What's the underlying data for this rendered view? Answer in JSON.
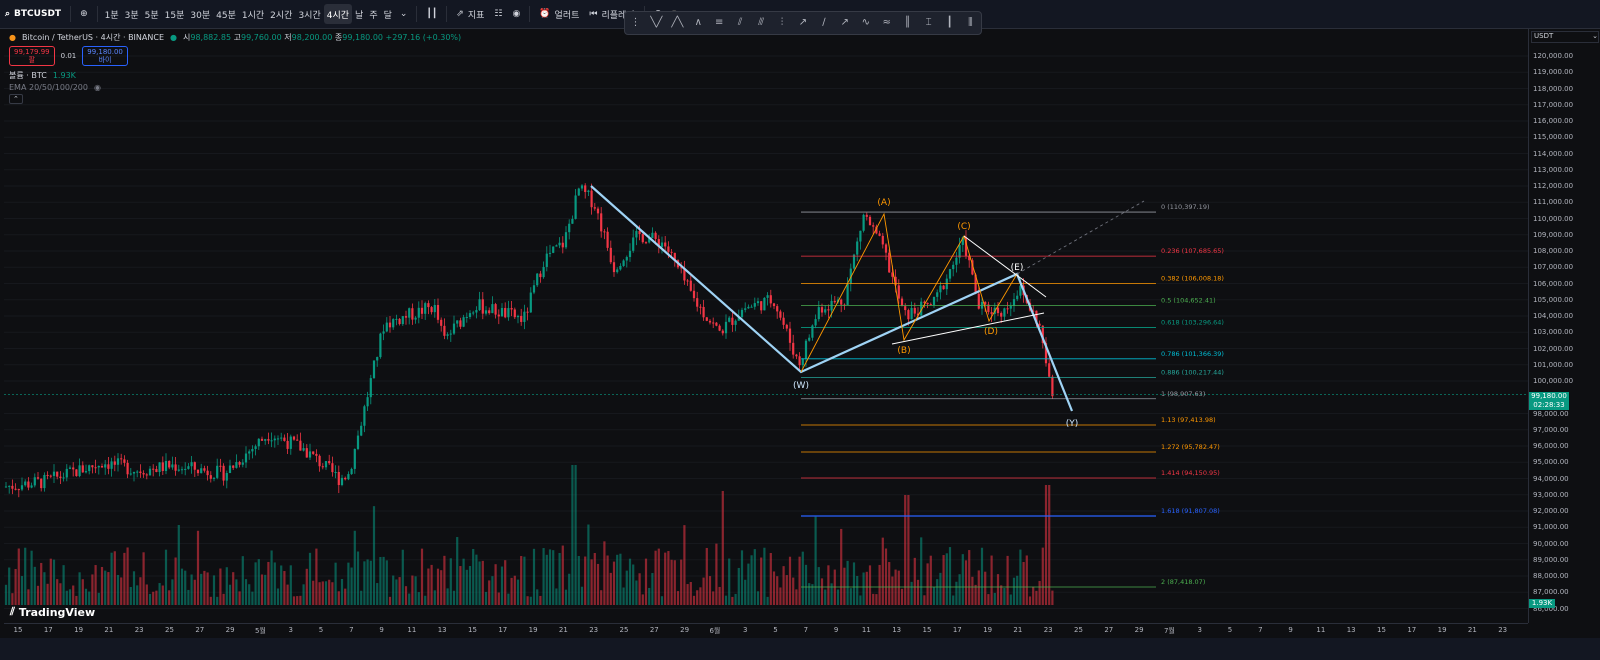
{
  "toolbar": {
    "symbol": "BTCUSDT",
    "timeframes": [
      "1분",
      "3분",
      "5분",
      "15분",
      "30분",
      "45분",
      "1시간",
      "2시간",
      "3시간",
      "4시간",
      "날",
      "주",
      "달"
    ],
    "active_timeframe": "4시간",
    "indicators_label": "지표",
    "alert_label": "얼러트",
    "replay_label": "리플레이"
  },
  "legend": {
    "title": "Bitcoin / TetherUS · 4시간 · BINANCE",
    "o_label": "시",
    "o_value": "98,882.85",
    "h_label": "고",
    "h_value": "99,760.00",
    "l_label": "저",
    "l_value": "98,200.00",
    "c_label": "종",
    "c_value": "99,180.00",
    "change": "+297.16 (+0.30%)",
    "sell_price": "99,179.99",
    "sell_label": "팔",
    "spread": "0.01",
    "buy_price": "99,180.00",
    "buy_label": "바이",
    "volume_label": "볼륨 · BTC",
    "volume_value": "1.93K",
    "ema_label": "EMA 20/50/100/200"
  },
  "price_scale": {
    "currency": "USDT",
    "ticks": [
      "120,000.00",
      "119,000.00",
      "118,000.00",
      "117,000.00",
      "116,000.00",
      "115,000.00",
      "114,000.00",
      "113,000.00",
      "112,000.00",
      "111,000.00",
      "110,000.00",
      "109,000.00",
      "108,000.00",
      "107,000.00",
      "106,000.00",
      "105,000.00",
      "104,000.00",
      "103,000.00",
      "102,000.00",
      "101,000.00",
      "100,000.00",
      "98,000.00",
      "97,000.00",
      "96,000.00",
      "95,000.00",
      "94,000.00",
      "93,000.00",
      "92,000.00",
      "91,000.00",
      "90,000.00",
      "89,000.00",
      "88,000.00",
      "87,000.00",
      "86,000.00"
    ],
    "last_price": "99,180.00",
    "countdown": "02:28:33",
    "volume_badge": "1.93K"
  },
  "time_axis": [
    "15",
    "17",
    "19",
    "21",
    "23",
    "25",
    "27",
    "29",
    "5월",
    "3",
    "5",
    "7",
    "9",
    "11",
    "13",
    "15",
    "17",
    "19",
    "21",
    "23",
    "25",
    "27",
    "29",
    "6월",
    "3",
    "5",
    "7",
    "9",
    "11",
    "13",
    "15",
    "17",
    "19",
    "21",
    "23",
    "25",
    "27",
    "29",
    "7월",
    "3",
    "5",
    "7",
    "9",
    "11",
    "13",
    "15",
    "17",
    "19",
    "21",
    "23"
  ],
  "fib_levels": [
    {
      "label": "0 (110,397.19)",
      "color": "#9598a1"
    },
    {
      "label": "0.236 (107,685.65)",
      "color": "#f23645"
    },
    {
      "label": "0.382 (106,008.18)",
      "color": "#ff9800"
    },
    {
      "label": "0.5 (104,652.41)",
      "color": "#4caf50"
    },
    {
      "label": "0.618 (103,296.64)",
      "color": "#089981"
    },
    {
      "label": "0.786 (101,366.39)",
      "color": "#00bcd4"
    },
    {
      "label": "0.886 (100,217.44)",
      "color": "#26a69a"
    },
    {
      "label": "1 (98,907.63)",
      "color": "#9598a1"
    },
    {
      "label": "1.13 (97,413.98)",
      "color": "#ff9800"
    },
    {
      "label": "1.272 (95,782.47)",
      "color": "#ff9800"
    },
    {
      "label": "1.414 (94,150.95)",
      "color": "#f23645"
    },
    {
      "label": "1.618 (91,807.08)",
      "color": "#2962ff"
    },
    {
      "label": "2 (87,418.07)",
      "color": "#4caf50"
    }
  ],
  "wave_labels": {
    "W": "(W)",
    "Y": "(Y)",
    "A": "(A)",
    "B": "(B)",
    "C": "(C)",
    "D": "(D)",
    "E": "(E)"
  },
  "brand": "TradingView",
  "colors": {
    "up": "#089981",
    "down": "#f23645",
    "accent": "#2962ff",
    "wave": "#9fd3f5",
    "abc": "#ff9800"
  }
}
